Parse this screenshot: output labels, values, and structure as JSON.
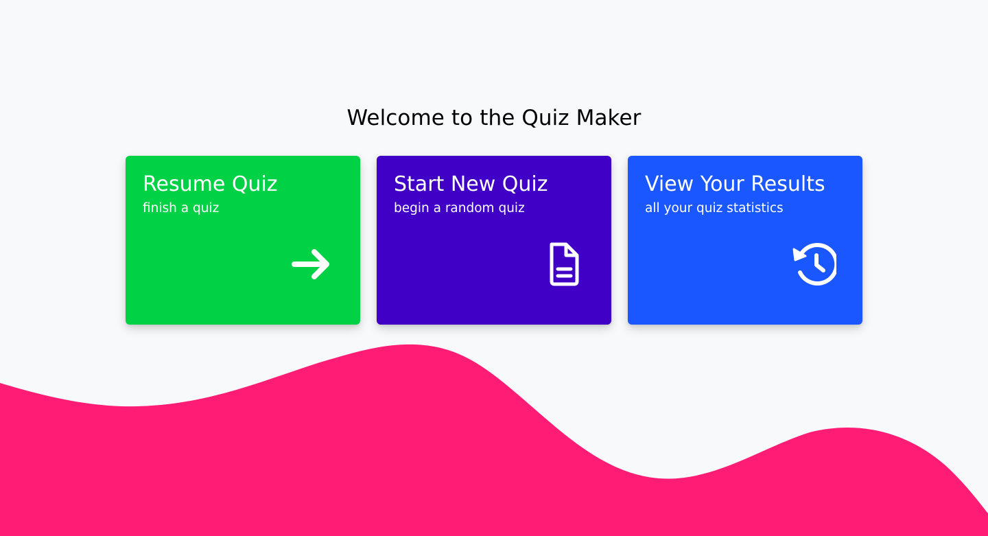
{
  "header": {
    "title": "Welcome to the Quiz Maker"
  },
  "cards": [
    {
      "title": "Resume Quiz",
      "subtitle": "finish a quiz",
      "icon": "arrow-right-icon",
      "color": "#00d145"
    },
    {
      "title": "Start New Quiz",
      "subtitle": "begin a random quiz",
      "icon": "document-icon",
      "color": "#4000c5"
    },
    {
      "title": "View Your Results",
      "subtitle": "all your quiz statistics",
      "icon": "history-icon",
      "color": "#1a57fe"
    }
  ],
  "colors": {
    "background": "#f7f9fb",
    "wave": "#ff1c74",
    "text": "#000000",
    "card_text": "#ffffff"
  }
}
